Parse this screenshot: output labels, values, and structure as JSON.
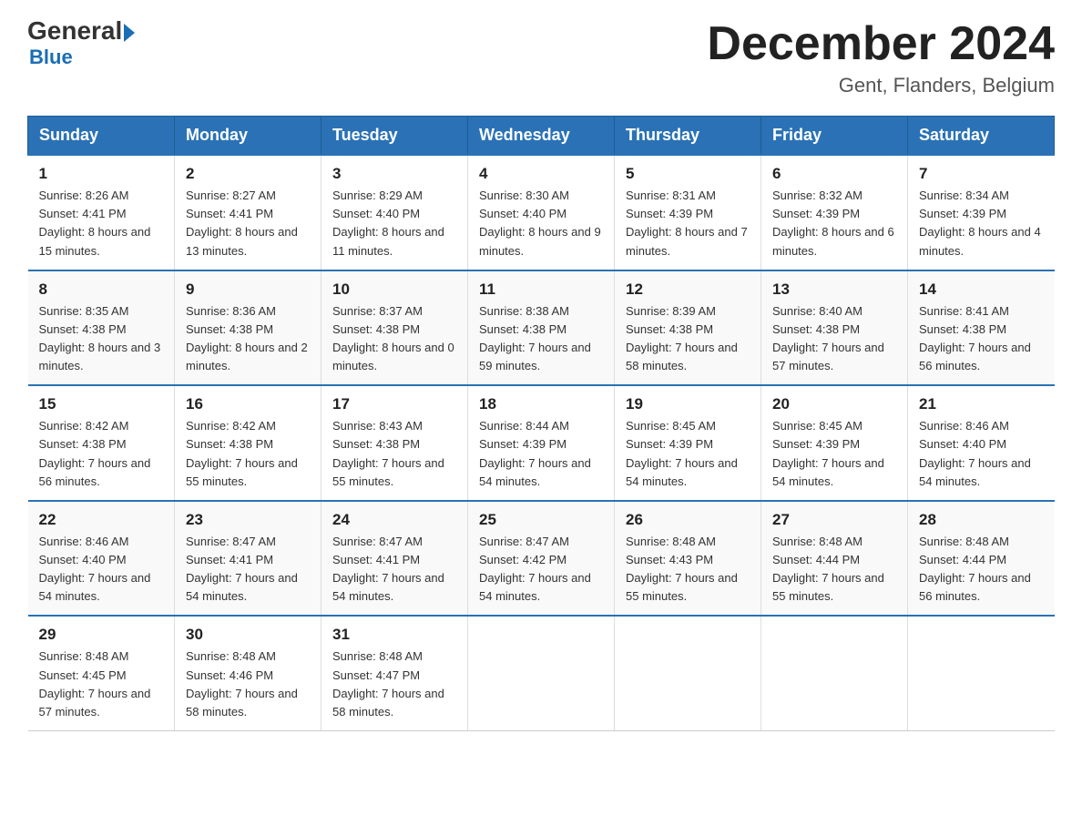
{
  "header": {
    "logo_general": "General",
    "logo_blue": "Blue",
    "calendar_title": "December 2024",
    "calendar_subtitle": "Gent, Flanders, Belgium"
  },
  "columns": [
    "Sunday",
    "Monday",
    "Tuesday",
    "Wednesday",
    "Thursday",
    "Friday",
    "Saturday"
  ],
  "weeks": [
    [
      {
        "day": "1",
        "sunrise": "8:26 AM",
        "sunset": "4:41 PM",
        "daylight": "8 hours and 15 minutes."
      },
      {
        "day": "2",
        "sunrise": "8:27 AM",
        "sunset": "4:41 PM",
        "daylight": "8 hours and 13 minutes."
      },
      {
        "day": "3",
        "sunrise": "8:29 AM",
        "sunset": "4:40 PM",
        "daylight": "8 hours and 11 minutes."
      },
      {
        "day": "4",
        "sunrise": "8:30 AM",
        "sunset": "4:40 PM",
        "daylight": "8 hours and 9 minutes."
      },
      {
        "day": "5",
        "sunrise": "8:31 AM",
        "sunset": "4:39 PM",
        "daylight": "8 hours and 7 minutes."
      },
      {
        "day": "6",
        "sunrise": "8:32 AM",
        "sunset": "4:39 PM",
        "daylight": "8 hours and 6 minutes."
      },
      {
        "day": "7",
        "sunrise": "8:34 AM",
        "sunset": "4:39 PM",
        "daylight": "8 hours and 4 minutes."
      }
    ],
    [
      {
        "day": "8",
        "sunrise": "8:35 AM",
        "sunset": "4:38 PM",
        "daylight": "8 hours and 3 minutes."
      },
      {
        "day": "9",
        "sunrise": "8:36 AM",
        "sunset": "4:38 PM",
        "daylight": "8 hours and 2 minutes."
      },
      {
        "day": "10",
        "sunrise": "8:37 AM",
        "sunset": "4:38 PM",
        "daylight": "8 hours and 0 minutes."
      },
      {
        "day": "11",
        "sunrise": "8:38 AM",
        "sunset": "4:38 PM",
        "daylight": "7 hours and 59 minutes."
      },
      {
        "day": "12",
        "sunrise": "8:39 AM",
        "sunset": "4:38 PM",
        "daylight": "7 hours and 58 minutes."
      },
      {
        "day": "13",
        "sunrise": "8:40 AM",
        "sunset": "4:38 PM",
        "daylight": "7 hours and 57 minutes."
      },
      {
        "day": "14",
        "sunrise": "8:41 AM",
        "sunset": "4:38 PM",
        "daylight": "7 hours and 56 minutes."
      }
    ],
    [
      {
        "day": "15",
        "sunrise": "8:42 AM",
        "sunset": "4:38 PM",
        "daylight": "7 hours and 56 minutes."
      },
      {
        "day": "16",
        "sunrise": "8:42 AM",
        "sunset": "4:38 PM",
        "daylight": "7 hours and 55 minutes."
      },
      {
        "day": "17",
        "sunrise": "8:43 AM",
        "sunset": "4:38 PM",
        "daylight": "7 hours and 55 minutes."
      },
      {
        "day": "18",
        "sunrise": "8:44 AM",
        "sunset": "4:39 PM",
        "daylight": "7 hours and 54 minutes."
      },
      {
        "day": "19",
        "sunrise": "8:45 AM",
        "sunset": "4:39 PM",
        "daylight": "7 hours and 54 minutes."
      },
      {
        "day": "20",
        "sunrise": "8:45 AM",
        "sunset": "4:39 PM",
        "daylight": "7 hours and 54 minutes."
      },
      {
        "day": "21",
        "sunrise": "8:46 AM",
        "sunset": "4:40 PM",
        "daylight": "7 hours and 54 minutes."
      }
    ],
    [
      {
        "day": "22",
        "sunrise": "8:46 AM",
        "sunset": "4:40 PM",
        "daylight": "7 hours and 54 minutes."
      },
      {
        "day": "23",
        "sunrise": "8:47 AM",
        "sunset": "4:41 PM",
        "daylight": "7 hours and 54 minutes."
      },
      {
        "day": "24",
        "sunrise": "8:47 AM",
        "sunset": "4:41 PM",
        "daylight": "7 hours and 54 minutes."
      },
      {
        "day": "25",
        "sunrise": "8:47 AM",
        "sunset": "4:42 PM",
        "daylight": "7 hours and 54 minutes."
      },
      {
        "day": "26",
        "sunrise": "8:48 AM",
        "sunset": "4:43 PM",
        "daylight": "7 hours and 55 minutes."
      },
      {
        "day": "27",
        "sunrise": "8:48 AM",
        "sunset": "4:44 PM",
        "daylight": "7 hours and 55 minutes."
      },
      {
        "day": "28",
        "sunrise": "8:48 AM",
        "sunset": "4:44 PM",
        "daylight": "7 hours and 56 minutes."
      }
    ],
    [
      {
        "day": "29",
        "sunrise": "8:48 AM",
        "sunset": "4:45 PM",
        "daylight": "7 hours and 57 minutes."
      },
      {
        "day": "30",
        "sunrise": "8:48 AM",
        "sunset": "4:46 PM",
        "daylight": "7 hours and 58 minutes."
      },
      {
        "day": "31",
        "sunrise": "8:48 AM",
        "sunset": "4:47 PM",
        "daylight": "7 hours and 58 minutes."
      },
      null,
      null,
      null,
      null
    ]
  ]
}
